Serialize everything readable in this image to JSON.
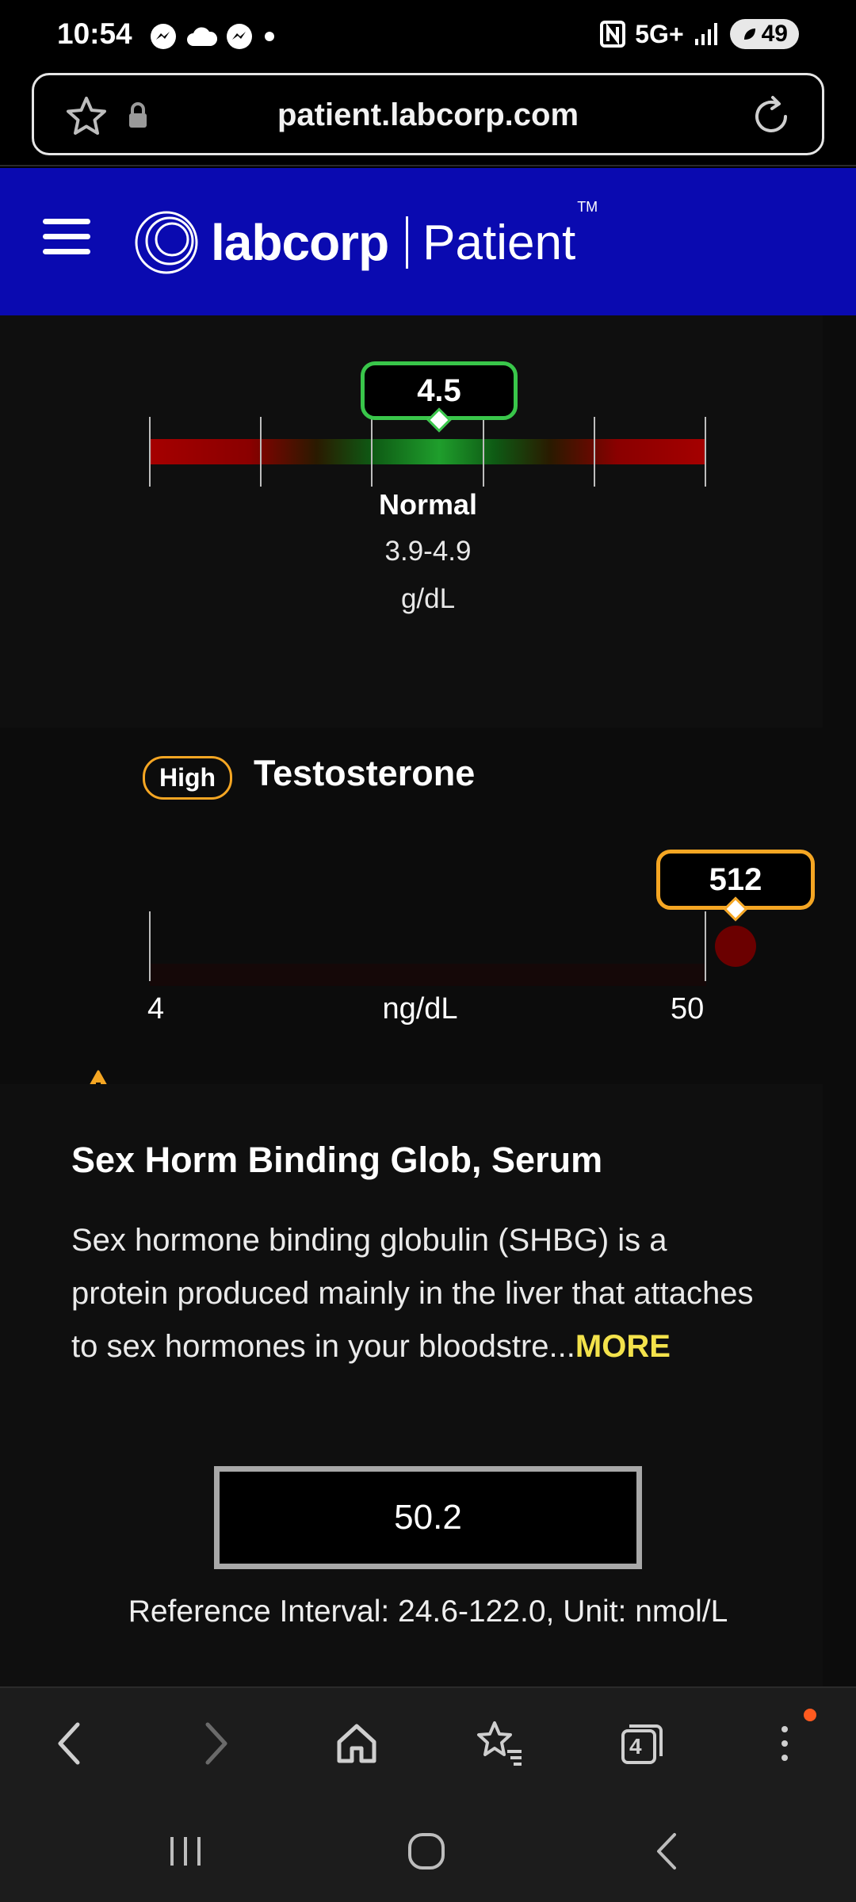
{
  "status_bar": {
    "time": "10:54",
    "network": "5G+",
    "battery": "49"
  },
  "browser": {
    "url": "patient.labcorp.com",
    "tab_count": "4"
  },
  "header": {
    "brand": "labcorp",
    "product": "Patient",
    "trademark": "TM"
  },
  "albumin_result": {
    "value": "4.5",
    "status": "Normal",
    "range": "3.9-4.9",
    "unit": "g/dL",
    "indicator_fraction": 0.52,
    "colors": {
      "normal": "#1f9e2c",
      "abnormal": "#a50000",
      "bubble_border": "#39c64a"
    }
  },
  "testosterone_result": {
    "flag": "High",
    "name": "Testosterone",
    "value": "512",
    "range_min": "4",
    "range_max": "50",
    "unit": "ng/dL",
    "colors": {
      "flag": "#f5a623",
      "out_of_range_dot": "#6b0000"
    }
  },
  "shbg_section": {
    "title": "Sex Horm Binding Glob, Serum",
    "description": "Sex hormone binding globulin (SHBG) is a protein produced mainly in the liver that attaches to sex hormones in your bloodstre...",
    "more_label": "MORE",
    "value": "50.2",
    "reference": "Reference Interval: 24.6-122.0, Unit: nmol/L"
  }
}
